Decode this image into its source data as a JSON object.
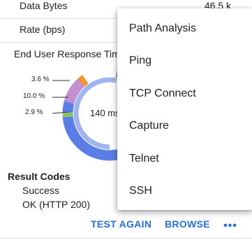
{
  "rows": [
    {
      "label": "Data Bytes",
      "value": "46.5 k"
    },
    {
      "label": "Rate (bps)",
      "value": ""
    }
  ],
  "response_section": {
    "title": "End User Response Tim",
    "center_value": "140 ms",
    "percents": [
      "3.6 %",
      "10.0 %",
      "2.9 %"
    ],
    "colors": {
      "ring_primary": "#5b7ee6",
      "ring_light": "#9fb3f0",
      "purple": "#c28fd0",
      "orange": "#f2962d",
      "green": "#8cc06b"
    }
  },
  "result_codes": {
    "title": "Result Codes",
    "status": "Success",
    "detail": "OK (HTTP 200)"
  },
  "footer": {
    "test_again": "TEST AGAIN",
    "browse": "BROWSE",
    "more": "•••"
  },
  "menu": {
    "items": [
      "Path Analysis",
      "Ping",
      "TCP Connect",
      "Capture",
      "Telnet",
      "SSH"
    ]
  }
}
